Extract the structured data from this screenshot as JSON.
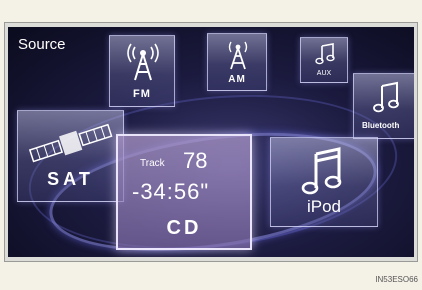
{
  "screen_title": "Source",
  "tiles": {
    "fm": {
      "label": "FM",
      "icon": "antenna-icon"
    },
    "am": {
      "label": "AM",
      "icon": "antenna-icon"
    },
    "aux": {
      "label": "AUX",
      "icon": "music-note-icon"
    },
    "bluetooth": {
      "label": "Bluetooth",
      "icon": "music-note-icon"
    },
    "sat": {
      "label": "SAT",
      "icon": "satellite-icon"
    },
    "ipod": {
      "label": "iPod",
      "icon": "music-note-icon"
    },
    "cd": {
      "label": "CD",
      "track_label": "Track",
      "track_number": "78",
      "time": "-34:56\""
    }
  },
  "figure_code": "IN53ESO66",
  "colors": {
    "background": "#1c1b40",
    "tile_border": "#dcdcff",
    "selected_tile": "#8e7ab0"
  }
}
